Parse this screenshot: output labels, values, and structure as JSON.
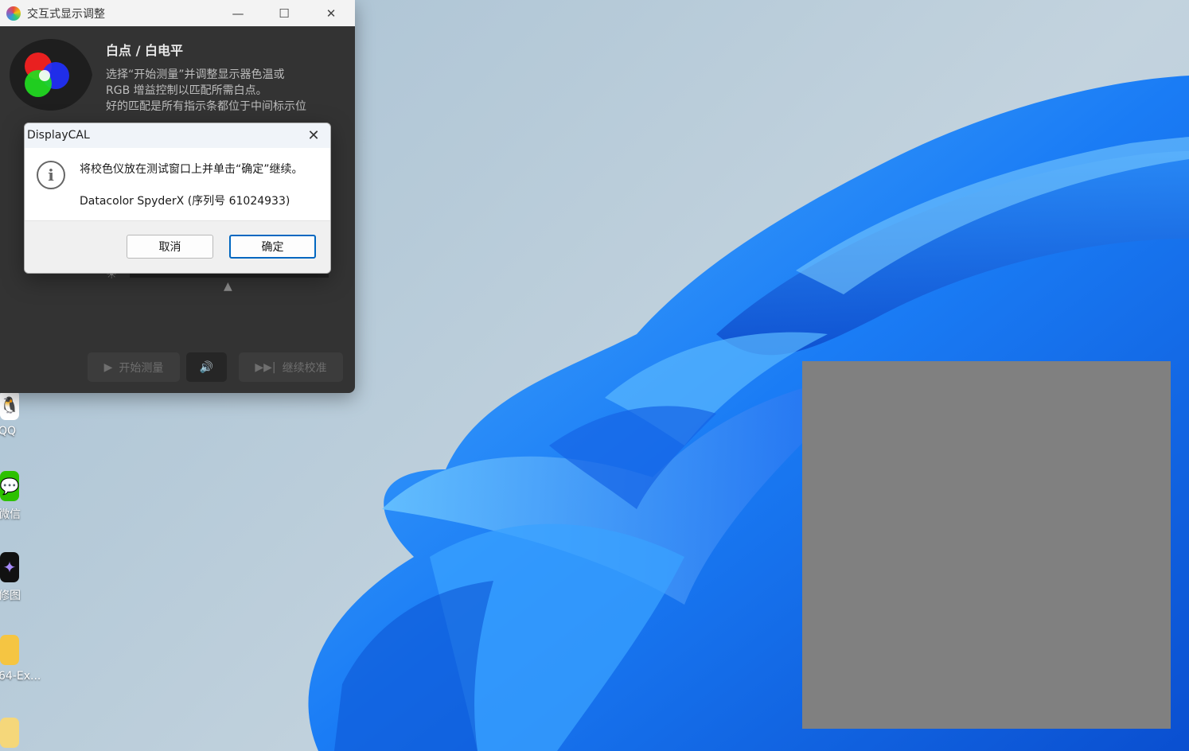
{
  "main_window": {
    "title": "交互式显示调整",
    "controls": {
      "minimize": "—",
      "maximize": "☐",
      "close": "✕"
    },
    "heading": "白点 / 白电平",
    "description": [
      "选择“开始测量”并调整显示器色温或",
      "RGB 增益控制以匹配所需白点。",
      "好的匹配是所有指示条都位于中间标示位"
    ],
    "buttons": {
      "start_label": "开始测量",
      "start_glyph": "▶",
      "sound_glyph": "🔊",
      "continue_label": "继续校准",
      "continue_glyph": "▶▶|"
    },
    "sun_glyph": "☀",
    "pointer_glyph": "▲"
  },
  "dialog": {
    "title": "DisplayCAL",
    "close_glyph": "✕",
    "info_glyph": "i",
    "message": "将校色仪放在测试窗口上并单击“确定”继续。",
    "device": "Datacolor SpyderX (序列号 61024933)",
    "cancel_label": "取消",
    "ok_label": "确定"
  },
  "desktop": {
    "icons": [
      {
        "name": "QQ",
        "label": "QQ",
        "color": "#ffffff"
      },
      {
        "name": "wechat",
        "label": "微信",
        "color": "#2dc100"
      },
      {
        "name": "retouch",
        "label": "醒图修图",
        "color": "#111111"
      },
      {
        "name": "folder",
        "label": "64-Ex...",
        "color": "#f5c542"
      },
      {
        "name": "drive",
        "label": "",
        "color": "#f5d77a"
      }
    ],
    "labels": [
      "QQ",
      "微信",
      "修图",
      "64-Ex..."
    ]
  },
  "colors": {
    "wallpaper_blue": "#1a7cf5",
    "test_patch": "#808080",
    "dialog_primary": "#0067c0"
  }
}
